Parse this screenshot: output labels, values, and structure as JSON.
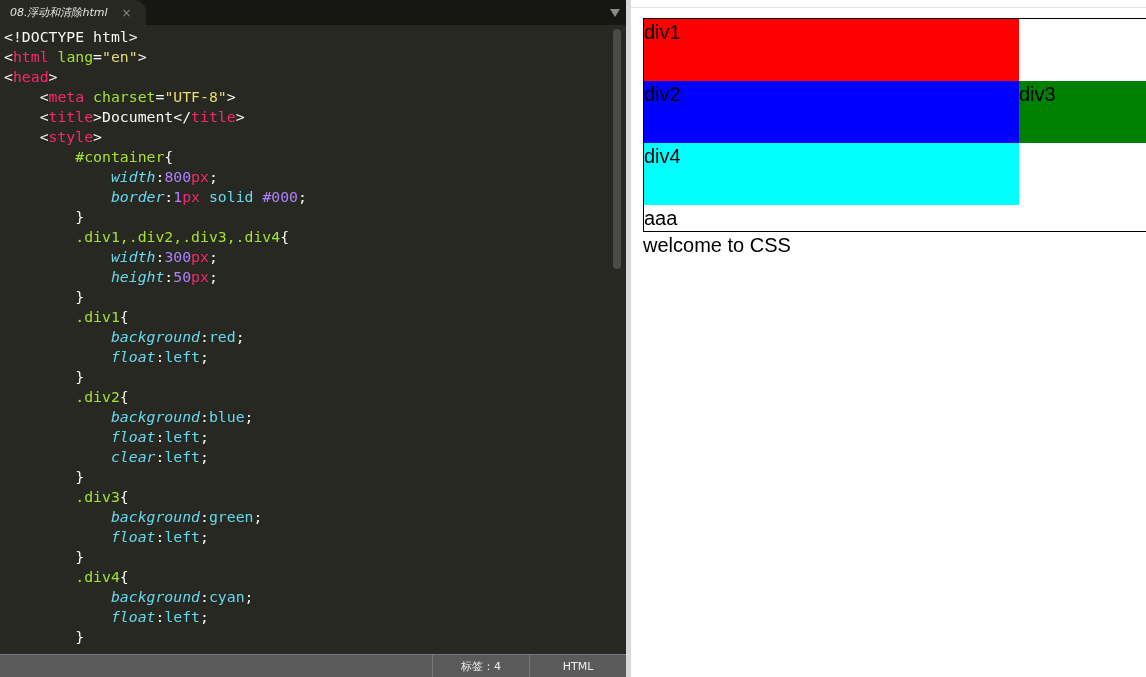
{
  "editor": {
    "tabs": [
      {
        "label": "08.浮动和清除html",
        "close": "×",
        "selected": true
      }
    ],
    "lines": [
      [
        {
          "t": "<!DOCTYPE html>",
          "kind": "plain"
        }
      ],
      [
        {
          "t": "<",
          "kind": "plain"
        },
        {
          "t": "html",
          "kind": "tag"
        },
        {
          "t": " lang",
          "kind": "attr"
        },
        {
          "t": "=",
          "kind": "plain"
        },
        {
          "t": "\"en\"",
          "kind": "string"
        },
        {
          "t": ">",
          "kind": "plain"
        }
      ],
      [
        {
          "t": "<",
          "kind": "plain"
        },
        {
          "t": "head",
          "kind": "tag"
        },
        {
          "t": ">",
          "kind": "plain"
        }
      ],
      [
        {
          "t": "    <",
          "kind": "plain"
        },
        {
          "t": "meta",
          "kind": "tag"
        },
        {
          "t": " charset",
          "kind": "attr"
        },
        {
          "t": "=",
          "kind": "plain"
        },
        {
          "t": "\"UTF-8\"",
          "kind": "string"
        },
        {
          "t": ">",
          "kind": "plain"
        }
      ],
      [
        {
          "t": "    <",
          "kind": "plain"
        },
        {
          "t": "title",
          "kind": "tag"
        },
        {
          "t": ">Document</",
          "kind": "plain"
        },
        {
          "t": "title",
          "kind": "tag"
        },
        {
          "t": ">",
          "kind": "plain"
        }
      ],
      [
        {
          "t": "    <",
          "kind": "plain"
        },
        {
          "t": "style",
          "kind": "tag"
        },
        {
          "t": ">",
          "kind": "plain"
        }
      ],
      [
        {
          "t": "        #container",
          "kind": "selector"
        },
        {
          "t": "{",
          "kind": "plain"
        }
      ],
      [
        {
          "t": "            width",
          "kind": "prop"
        },
        {
          "t": ":",
          "kind": "plain"
        },
        {
          "t": "800",
          "kind": "num"
        },
        {
          "t": "px",
          "kind": "tag"
        },
        {
          "t": ";",
          "kind": "plain"
        }
      ],
      [
        {
          "t": "            border",
          "kind": "prop"
        },
        {
          "t": ":",
          "kind": "plain"
        },
        {
          "t": "1",
          "kind": "num"
        },
        {
          "t": "px",
          "kind": "tag"
        },
        {
          "t": " solid ",
          "kind": "value"
        },
        {
          "t": "#000",
          "kind": "num"
        },
        {
          "t": ";",
          "kind": "plain"
        }
      ],
      [
        {
          "t": "        }",
          "kind": "plain"
        }
      ],
      [
        {
          "t": "        .div1,.div2,.div3,.div4",
          "kind": "selector"
        },
        {
          "t": "{",
          "kind": "plain"
        }
      ],
      [
        {
          "t": "            width",
          "kind": "prop"
        },
        {
          "t": ":",
          "kind": "plain"
        },
        {
          "t": "300",
          "kind": "num"
        },
        {
          "t": "px",
          "kind": "tag"
        },
        {
          "t": ";",
          "kind": "plain"
        }
      ],
      [
        {
          "t": "            height",
          "kind": "prop"
        },
        {
          "t": ":",
          "kind": "plain"
        },
        {
          "t": "50",
          "kind": "num"
        },
        {
          "t": "px",
          "kind": "tag"
        },
        {
          "t": ";",
          "kind": "plain"
        }
      ],
      [
        {
          "t": "        }",
          "kind": "plain"
        }
      ],
      [
        {
          "t": "        .div1",
          "kind": "selector"
        },
        {
          "t": "{",
          "kind": "plain"
        }
      ],
      [
        {
          "t": "            background",
          "kind": "prop"
        },
        {
          "t": ":",
          "kind": "plain"
        },
        {
          "t": "red",
          "kind": "value"
        },
        {
          "t": ";",
          "kind": "plain"
        }
      ],
      [
        {
          "t": "            float",
          "kind": "prop"
        },
        {
          "t": ":",
          "kind": "plain"
        },
        {
          "t": "left",
          "kind": "value"
        },
        {
          "t": ";",
          "kind": "plain"
        }
      ],
      [
        {
          "t": "        }",
          "kind": "plain"
        }
      ],
      [
        {
          "t": "        .div2",
          "kind": "selector"
        },
        {
          "t": "{",
          "kind": "plain"
        }
      ],
      [
        {
          "t": "            background",
          "kind": "prop"
        },
        {
          "t": ":",
          "kind": "plain"
        },
        {
          "t": "blue",
          "kind": "value"
        },
        {
          "t": ";",
          "kind": "plain"
        }
      ],
      [
        {
          "t": "            float",
          "kind": "prop"
        },
        {
          "t": ":",
          "kind": "plain"
        },
        {
          "t": "left",
          "kind": "value"
        },
        {
          "t": ";",
          "kind": "plain"
        }
      ],
      [
        {
          "t": "            clear",
          "kind": "prop"
        },
        {
          "t": ":",
          "kind": "plain"
        },
        {
          "t": "left",
          "kind": "value"
        },
        {
          "t": ";",
          "kind": "plain"
        }
      ],
      [
        {
          "t": "        }",
          "kind": "plain"
        }
      ],
      [
        {
          "t": "        .div3",
          "kind": "selector"
        },
        {
          "t": "{",
          "kind": "plain"
        }
      ],
      [
        {
          "t": "            background",
          "kind": "prop"
        },
        {
          "t": ":",
          "kind": "plain"
        },
        {
          "t": "green",
          "kind": "value"
        },
        {
          "t": ";",
          "kind": "plain"
        }
      ],
      [
        {
          "t": "            float",
          "kind": "prop"
        },
        {
          "t": ":",
          "kind": "plain"
        },
        {
          "t": "left",
          "kind": "value"
        },
        {
          "t": ";",
          "kind": "plain"
        }
      ],
      [
        {
          "t": "        }",
          "kind": "plain"
        }
      ],
      [
        {
          "t": "        .div4",
          "kind": "selector"
        },
        {
          "t": "{",
          "kind": "plain"
        }
      ],
      [
        {
          "t": "            background",
          "kind": "prop"
        },
        {
          "t": ":",
          "kind": "plain"
        },
        {
          "t": "cyan",
          "kind": "value"
        },
        {
          "t": ";",
          "kind": "plain"
        }
      ],
      [
        {
          "t": "            float",
          "kind": "prop"
        },
        {
          "t": ":",
          "kind": "plain"
        },
        {
          "t": "left",
          "kind": "value"
        },
        {
          "t": ";",
          "kind": "plain"
        }
      ],
      [
        {
          "t": "        }",
          "kind": "plain"
        }
      ]
    ],
    "status_bar": [
      "标签：4",
      "HTML"
    ]
  },
  "preview": {
    "rows": [
      [
        {
          "label": "div1",
          "color": "#ff0000"
        }
      ],
      [
        {
          "label": "div2",
          "color": "#0000ff"
        },
        {
          "label": "div3",
          "color": "#008000"
        }
      ],
      [
        {
          "label": "div4",
          "color": "#00ffff"
        }
      ]
    ],
    "container_text": "aaa",
    "after_text": "welcome to CSS"
  }
}
